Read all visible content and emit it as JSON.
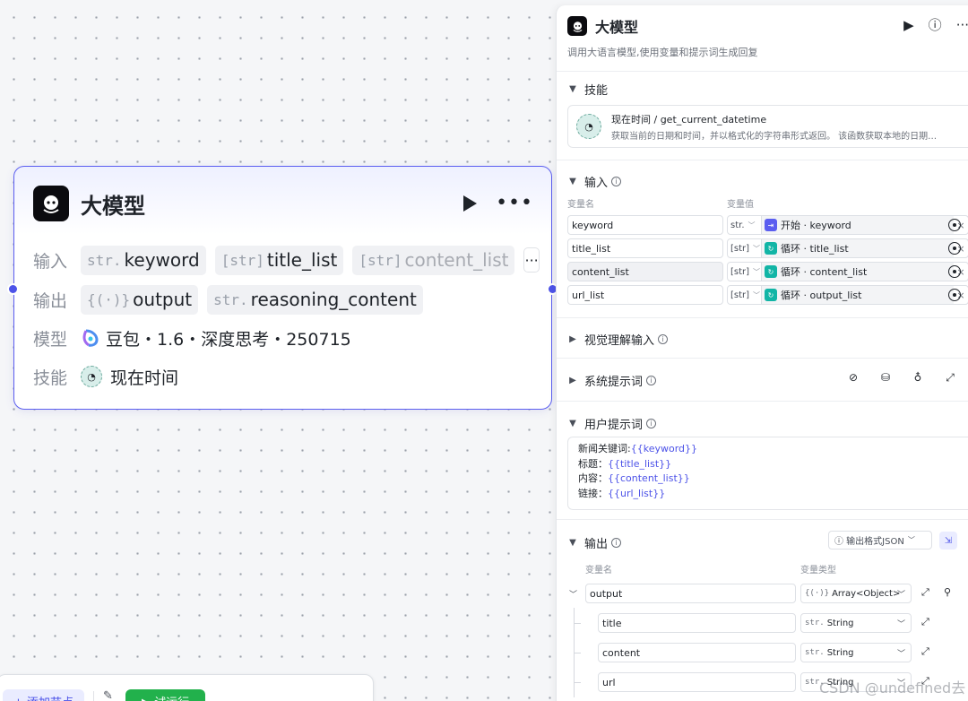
{
  "node": {
    "title": "大模型",
    "inputs_label": "输入",
    "inputs": [
      {
        "type": "str.",
        "name": "keyword"
      },
      {
        "type": "[str]",
        "name": "title_list"
      },
      {
        "type": "[str]",
        "name": "content_list"
      }
    ],
    "inputs_more": "···",
    "outputs_label": "输出",
    "outputs": [
      {
        "type": "{(·)}",
        "name": "output"
      },
      {
        "type": "str.",
        "name": "reasoning_content"
      }
    ],
    "model_label": "模型",
    "model_value": "豆包・1.6・深度思考・250715",
    "skills_label": "技能",
    "skill_value": "现在时间"
  },
  "toolbar": {
    "add_node": "+ 添加节点",
    "run": "▶ 试运行"
  },
  "panel": {
    "title": "大模型",
    "description": "调用大语言模型,使用变量和提示词生成回复",
    "skills_section": "技能",
    "skill": {
      "name": "现在时间 / get_current_datetime",
      "description": "获取当前的日期和时间，并以格式化的字符串形式返回。 该函数获取本地的日期…"
    },
    "input_section": "输入",
    "col_var_name": "变量名",
    "col_var_value": "变量值",
    "input_rows": [
      {
        "name": "keyword",
        "type": "str.",
        "ref_source": "开始",
        "ref_var": "keyword",
        "kind": "start"
      },
      {
        "name": "title_list",
        "type": "[str]",
        "ref_source": "循环",
        "ref_var": "title_list",
        "kind": "loop"
      },
      {
        "name": "content_list",
        "type": "[str]",
        "ref_source": "循环",
        "ref_var": "content_list",
        "kind": "loop"
      },
      {
        "name": "url_list",
        "type": "[str]",
        "ref_source": "循环",
        "ref_var": "output_list",
        "kind": "loop"
      }
    ],
    "vision_section": "视觉理解输入",
    "system_prompt_section": "系统提示词",
    "user_prompt_section": "用户提示词",
    "user_prompt_lines": [
      {
        "label": "新闻关键词:",
        "var": "{{keyword}}"
      },
      {
        "label": "标题：",
        "var": "{{title_list}}"
      },
      {
        "label": "内容：",
        "var": "{{content_list}}"
      },
      {
        "label": "链接：",
        "var": "{{url_list}}"
      }
    ],
    "output_section": "输出",
    "output_format": "ⓘ 输出格式JSON",
    "col_out_name": "变量名",
    "col_out_type": "变量类型",
    "output_rows": [
      {
        "name": "output",
        "type_tag": "{(·)}",
        "type": "Array<Object>"
      },
      {
        "name": "title",
        "type_tag": "str.",
        "type": "String"
      },
      {
        "name": "content",
        "type_tag": "str.",
        "type": "String"
      },
      {
        "name": "url",
        "type_tag": "str.",
        "type": "String"
      }
    ]
  },
  "watermark": "CSDN @undefined去"
}
